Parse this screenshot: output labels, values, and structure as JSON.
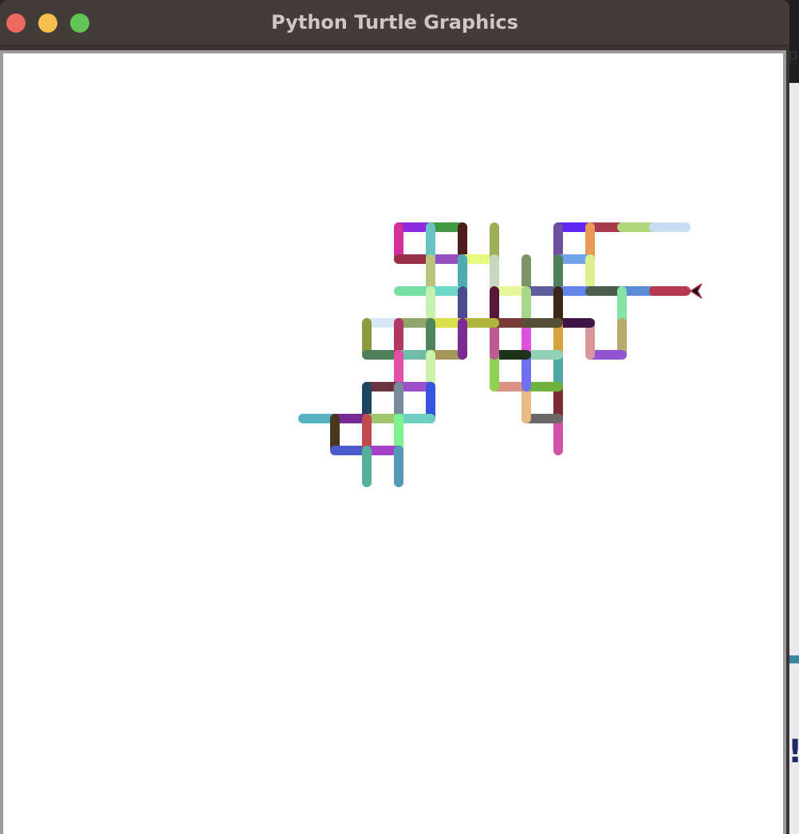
{
  "window": {
    "title": "Python Turtle Graphics",
    "controls": [
      "close",
      "minimize",
      "maximize"
    ]
  },
  "background_window": {
    "partial_text": "pi",
    "partial_glyph": "!"
  },
  "turtle": {
    "icon": "classic-arrow-icon",
    "heading": "west",
    "color": "#b7384c"
  }
}
